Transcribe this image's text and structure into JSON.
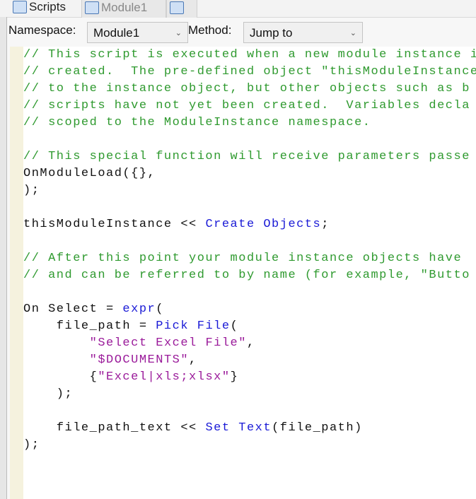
{
  "tabs": [
    {
      "label": "Scripts",
      "icon": "script-icon"
    },
    {
      "label": "Module1",
      "icon": "module-icon"
    },
    {
      "label": "",
      "icon": "new-module-icon"
    }
  ],
  "toolbar": {
    "namespace_label": "Namespace:",
    "namespace_value": "Module1",
    "method_label": "Method:",
    "method_value": "Jump to"
  },
  "colors": {
    "comment": "#2f9a2f",
    "keyword": "#1a1ad6",
    "string": "#9a1a9a",
    "text": "#111111"
  },
  "code": [
    [
      {
        "t": "// This script is executed when a new module instance is",
        "c": "comment"
      }
    ],
    [
      {
        "t": "// created.  The pre-defined object \"thisModuleInstance\"",
        "c": "comment"
      }
    ],
    [
      {
        "t": "// to the instance object, but other objects such as b",
        "c": "comment"
      }
    ],
    [
      {
        "t": "// scripts have not yet been created.  Variables decla",
        "c": "comment"
      }
    ],
    [
      {
        "t": "// scoped to the ModuleInstance namespace.",
        "c": "comment"
      }
    ],
    [],
    [
      {
        "t": "// This special function will receive parameters passe",
        "c": "comment"
      }
    ],
    [
      {
        "t": "OnModuleLoad({},",
        "c": "text"
      }
    ],
    [
      {
        "t": ");",
        "c": "text"
      }
    ],
    [],
    [
      {
        "t": "thisModuleInstance << ",
        "c": "text"
      },
      {
        "t": "Create Objects",
        "c": "keyword"
      },
      {
        "t": ";",
        "c": "text"
      }
    ],
    [],
    [
      {
        "t": "// After this point your module instance objects have",
        "c": "comment"
      }
    ],
    [
      {
        "t": "// and can be referred to by name (for example, \"Butto",
        "c": "comment"
      }
    ],
    [],
    [
      {
        "t": "On Select = ",
        "c": "text"
      },
      {
        "t": "expr",
        "c": "keyword"
      },
      {
        "t": "(",
        "c": "text"
      }
    ],
    [
      {
        "t": "    file_path = ",
        "c": "text"
      },
      {
        "t": "Pick File",
        "c": "keyword"
      },
      {
        "t": "(",
        "c": "text"
      }
    ],
    [
      {
        "t": "        ",
        "c": "text"
      },
      {
        "t": "\"Select Excel File\"",
        "c": "string"
      },
      {
        "t": ",",
        "c": "text"
      }
    ],
    [
      {
        "t": "        ",
        "c": "text"
      },
      {
        "t": "\"$DOCUMENTS\"",
        "c": "string"
      },
      {
        "t": ",",
        "c": "text"
      }
    ],
    [
      {
        "t": "        {",
        "c": "text"
      },
      {
        "t": "\"Excel|xls;xlsx\"",
        "c": "string"
      },
      {
        "t": "}",
        "c": "text"
      }
    ],
    [
      {
        "t": "    );",
        "c": "text"
      }
    ],
    [],
    [
      {
        "t": "    file_path_text << ",
        "c": "text"
      },
      {
        "t": "Set Text",
        "c": "keyword"
      },
      {
        "t": "(file_path)",
        "c": "text"
      }
    ],
    [
      {
        "t": ");",
        "c": "text"
      }
    ]
  ]
}
